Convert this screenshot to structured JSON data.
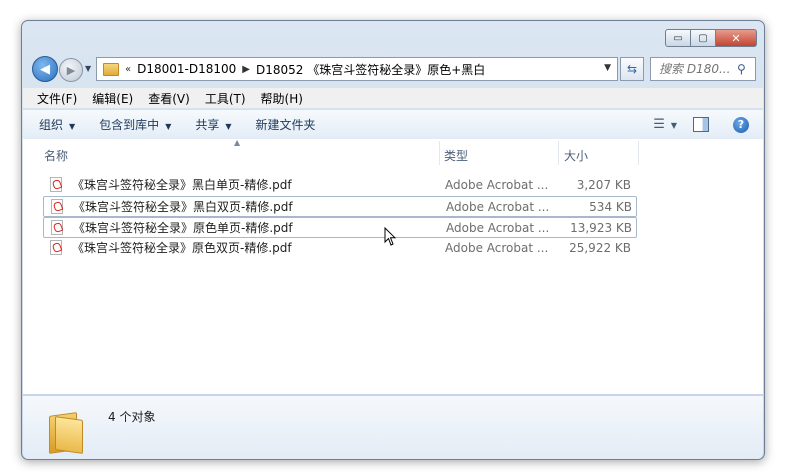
{
  "window": {
    "buttons": {
      "minimize": "▭",
      "maximize": "▢",
      "close": "✕"
    }
  },
  "nav": {
    "back": "◀",
    "forward": "▶",
    "overflow": "«",
    "breadcrumb": [
      "D18001-D18100",
      "D18052 《珠宫斗签符秘全录》原色+黑白"
    ],
    "search_placeholder": "搜索 D180..."
  },
  "menu": [
    "文件(F)",
    "编辑(E)",
    "查看(V)",
    "工具(T)",
    "帮助(H)"
  ],
  "toolbar": [
    "组织",
    "包含到库中",
    "共享",
    "新建文件夹"
  ],
  "columns": {
    "name": "名称",
    "type": "类型",
    "size": "大小"
  },
  "files": [
    {
      "name": "《珠宫斗签符秘全录》黑白单页-精修.pdf",
      "type": "Adobe Acrobat ...",
      "size": "3,207 KB",
      "highlight": false
    },
    {
      "name": "《珠宫斗签符秘全录》黑白双页-精修.pdf",
      "type": "Adobe Acrobat ...",
      "size": "534 KB",
      "highlight": true
    },
    {
      "name": "《珠宫斗签符秘全录》原色单页-精修.pdf",
      "type": "Adobe Acrobat ...",
      "size": "13,923 KB",
      "highlight": true
    },
    {
      "name": "《珠宫斗签符秘全录》原色双页-精修.pdf",
      "type": "Adobe Acrobat ...",
      "size": "25,922 KB",
      "highlight": false
    }
  ],
  "status": {
    "count": "4 个对象"
  },
  "icons": {
    "file": "pdf-icon",
    "folder": "folder-icon",
    "search": "search-icon",
    "help": "help-icon"
  },
  "colors": {
    "accent": "#2a6fc0",
    "pdf_red": "#d7261c",
    "close_red": "#c2452f"
  }
}
